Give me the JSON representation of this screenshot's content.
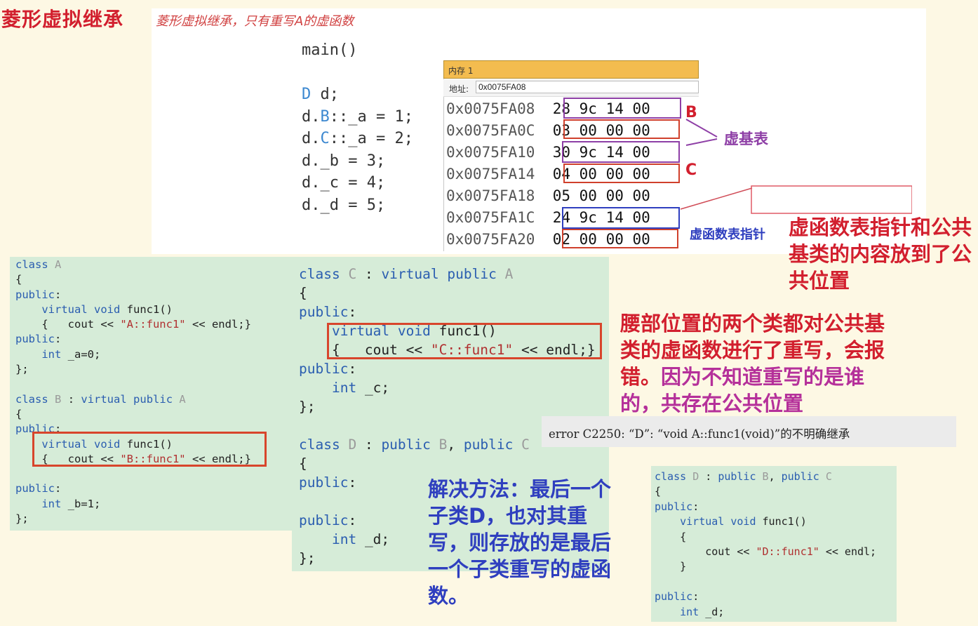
{
  "title": "菱形虚拟继承",
  "subtitle": "菱形虚拟继承，只有重写A的虚函数",
  "main_code": [
    "main()",
    "",
    "D d;",
    "d.B::_a = 1;",
    "d.C::_a = 2;",
    "d._b = 3;",
    "d._c = 4;",
    "d._d = 5;"
  ],
  "memory": {
    "title": "内存 1",
    "addr_label": "地址:",
    "addr_value": "0x0075FA08",
    "rows": [
      {
        "addr": "0x0075FA08",
        "bytes": "28 9c 14 00"
      },
      {
        "addr": "0x0075FA0C",
        "bytes": "03 00 00 00"
      },
      {
        "addr": "0x0075FA10",
        "bytes": "30 9c 14 00"
      },
      {
        "addr": "0x0075FA14",
        "bytes": "04 00 00 00"
      },
      {
        "addr": "0x0075FA18",
        "bytes": "05 00 00 00"
      },
      {
        "addr": "0x0075FA1C",
        "bytes": "24 9c 14 00"
      },
      {
        "addr": "0x0075FA20",
        "bytes": "02 00 00 00"
      }
    ]
  },
  "labels": {
    "b": "B",
    "c": "C",
    "vbase_table": "虚基表",
    "vfptr": "虚函数表指针"
  },
  "notes": {
    "shared": "虚函数表指针和公共基类的内容放到了公共位置",
    "waist_red": "腰部位置的两个类都对公共基类的虚函数进行了重写，会报错。",
    "waist_purple": "因为不知道重写的是谁的，共存在公共位置",
    "solution": "解决方法：最后一个子类D，也对其重写，则存放的是最后一个子类重写的虚函数。"
  },
  "error_text": "error C2250: “D”: “void A::func1(void)”的不明确继承",
  "colors": {
    "red": "#d21f2e",
    "purple": "#8e3fa6",
    "blue": "#2f3fbf",
    "memory_title": "#f3bc4f"
  }
}
